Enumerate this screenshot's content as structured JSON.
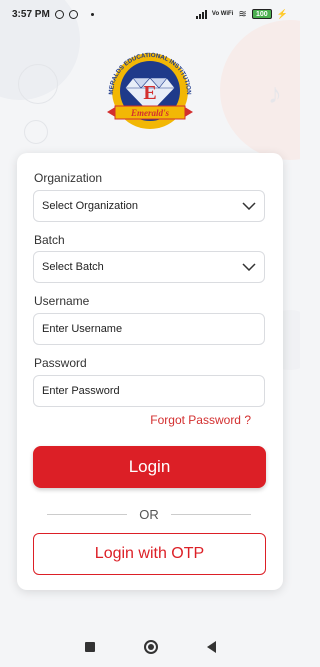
{
  "status_bar": {
    "time": "3:57 PM",
    "network_type": "Vo WiFi",
    "battery": "100"
  },
  "logo": {
    "arc_text": "EMERALDS EDUCATIONAL INSTITUTIONS",
    "letter": "E",
    "banner_text": "Emerald's"
  },
  "form": {
    "organization_label": "Organization",
    "organization_value": "Select Organization",
    "batch_label": "Batch",
    "batch_value": "Select Batch",
    "username_label": "Username",
    "username_placeholder": "Enter Username",
    "password_label": "Password",
    "password_placeholder": "Enter Password",
    "forgot_password": "Forgot Password ?",
    "login_button": "Login",
    "or_text": "OR",
    "otp_button": "Login with OTP"
  },
  "colors": {
    "accent": "#dc1f26",
    "logo_blue": "#1f3a8a",
    "logo_gold": "#f2b705"
  },
  "icons": [
    "chevron-down-icon",
    "signal-icon",
    "wifi-icon",
    "battery-icon",
    "recents-icon",
    "home-icon",
    "back-icon"
  ]
}
